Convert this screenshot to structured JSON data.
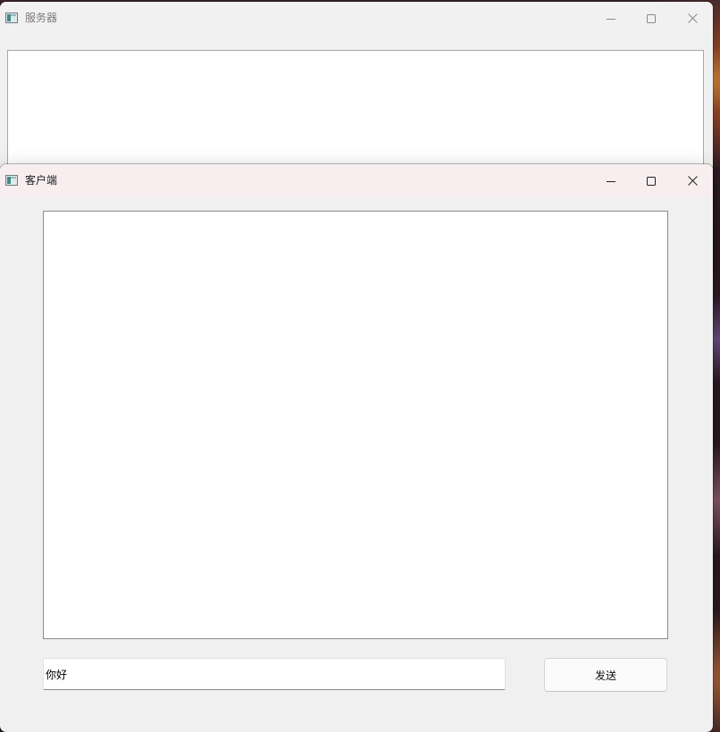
{
  "server_window": {
    "title": "服务器",
    "icon": "app-window-icon",
    "controls": [
      "minimize-icon",
      "maximize-icon",
      "close-icon"
    ]
  },
  "client_window": {
    "title": "客户端",
    "icon": "app-window-icon",
    "controls": [
      "minimize-icon",
      "maximize-icon",
      "close-icon"
    ],
    "message_input": {
      "value": "你好"
    },
    "send_button_label": "发送"
  }
}
